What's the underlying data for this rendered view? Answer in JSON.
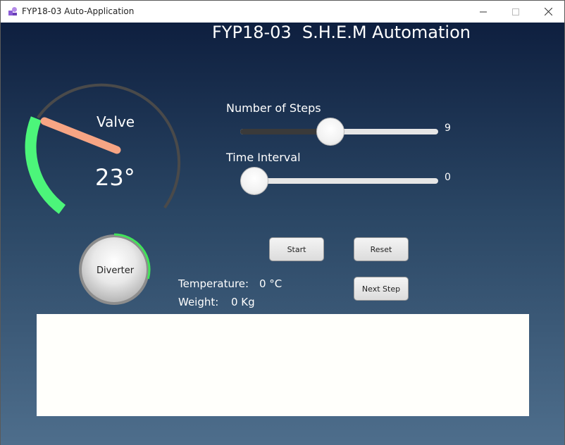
{
  "window": {
    "title": "FYP18-03 Auto-Application"
  },
  "header": {
    "title": "FYP18-03  S.H.E.M Automation"
  },
  "gauge": {
    "label": "Valve",
    "value_text": "23°",
    "value": 23
  },
  "sliders": {
    "steps": {
      "label": "Number of Steps",
      "value": "9",
      "fraction": 0.45
    },
    "interval": {
      "label": "Time Interval",
      "value": "0",
      "fraction": 0.0
    }
  },
  "buttons": {
    "start": "Start",
    "reset": "Reset",
    "next_step": "Next Step"
  },
  "dial": {
    "label": "Diverter"
  },
  "readings": {
    "temperature_label": "Temperature:",
    "temperature_value": "0 °C",
    "weight_label": "Weight:",
    "weight_value": "0 Kg"
  },
  "log": {
    "content": ""
  },
  "colors": {
    "gauge_progress": "#4cf57a",
    "needle": "#f7a584",
    "gauge_track": "#4a4a4a"
  }
}
